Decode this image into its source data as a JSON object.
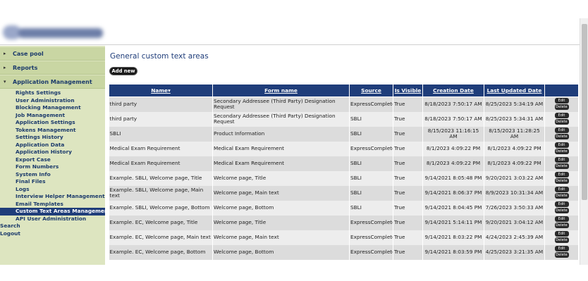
{
  "sidebar": {
    "sections": [
      {
        "label": "Case pool"
      },
      {
        "label": "Reports"
      },
      {
        "label": "Application Management"
      }
    ],
    "items": [
      {
        "label": "Rights Settings"
      },
      {
        "label": "User Administration"
      },
      {
        "label": "Blocking Management"
      },
      {
        "label": "Job Management"
      },
      {
        "label": "Application Settings"
      },
      {
        "label": "Tokens Management"
      },
      {
        "label": "Settings History"
      },
      {
        "label": "Application Data"
      },
      {
        "label": "Application History"
      },
      {
        "label": "Export Case"
      },
      {
        "label": "Form Numbers"
      },
      {
        "label": "System Info"
      },
      {
        "label": "Final Files"
      },
      {
        "label": "Logs"
      },
      {
        "label": "Interview Helper Management"
      },
      {
        "label": "Email Templates"
      },
      {
        "label": "Custom Text Areas Management"
      },
      {
        "label": "API User Administration"
      }
    ],
    "active_item": "Custom Text Areas Management",
    "root_items": [
      {
        "label": "Search"
      },
      {
        "label": "Logout"
      }
    ]
  },
  "main": {
    "title": "General custom text areas",
    "add_button": "Add new",
    "columns": {
      "name": "Name",
      "form_name": "Form name",
      "source": "Source",
      "is_visible": "Is Visible",
      "creation_date": "Creation Date",
      "last_updated": "Last Updated Date"
    },
    "edit_label": "Edit",
    "delete_label": "Delete",
    "rows": [
      {
        "name": "third party",
        "form": "Secondary Addressee (Third Party) Designation Request",
        "source": "ExpressComplete",
        "visible": "True",
        "created": "8/18/2023 7:50:17 AM",
        "updated": "8/25/2023 5:34:19 AM"
      },
      {
        "name": "third party",
        "form": "Secondary Addressee (Third Party) Designation Request",
        "source": "SBLI",
        "visible": "True",
        "created": "8/18/2023 7:50:17 AM",
        "updated": "8/25/2023 5:34:31 AM"
      },
      {
        "name": "SBLI",
        "form": "Product Information",
        "source": "SBLI",
        "visible": "True",
        "created": "8/15/2023 11:16:15 AM",
        "updated": "8/15/2023 11:28:25 AM"
      },
      {
        "name": "Medical Exam Requirement",
        "form": "Medical Exam Requirement",
        "source": "ExpressComplete",
        "visible": "True",
        "created": "8/1/2023 4:09:22 PM",
        "updated": "8/1/2023 4:09:22 PM"
      },
      {
        "name": "Medical Exam Requirement",
        "form": "Medical Exam Requirement",
        "source": "SBLI",
        "visible": "True",
        "created": "8/1/2023 4:09:22 PM",
        "updated": "8/1/2023 4:09:22 PM"
      },
      {
        "name": "Example. SBLI, Welcome page, Title",
        "form": "Welcome page, Title",
        "source": "SBLI",
        "visible": "True",
        "created": "9/14/2021 8:05:48 PM",
        "updated": "9/20/2021 3:03:22 AM"
      },
      {
        "name": "Example. SBLI, Welcome page, Main text",
        "form": "Welcome page, Main text",
        "source": "SBLI",
        "visible": "True",
        "created": "9/14/2021 8:06:37 PM",
        "updated": "8/9/2023 10:31:34 AM"
      },
      {
        "name": "Example. SBLI, Welcome page, Bottom",
        "form": "Welcome page, Bottom",
        "source": "SBLI",
        "visible": "True",
        "created": "9/14/2021 8:04:45 PM",
        "updated": "7/26/2023 3:50:33 AM"
      },
      {
        "name": "Example. EC, Welcome page, Title",
        "form": "Welcome page, Title",
        "source": "ExpressComplete",
        "visible": "True",
        "created": "9/14/2021 5:14:11 PM",
        "updated": "9/20/2021 3:04:12 AM"
      },
      {
        "name": "Example. EC, Welcome page, Main text",
        "form": "Welcome page, Main text",
        "source": "ExpressComplete",
        "visible": "True",
        "created": "9/14/2021 8:03:22 PM",
        "updated": "4/24/2023 2:45:39 AM"
      },
      {
        "name": "Example. EC, Welcome page, Bottom",
        "form": "Welcome page, Bottom",
        "source": "ExpressComplete",
        "visible": "True",
        "created": "9/14/2021 8:03:59 PM",
        "updated": "4/25/2023 3:21:35 AM"
      }
    ]
  }
}
